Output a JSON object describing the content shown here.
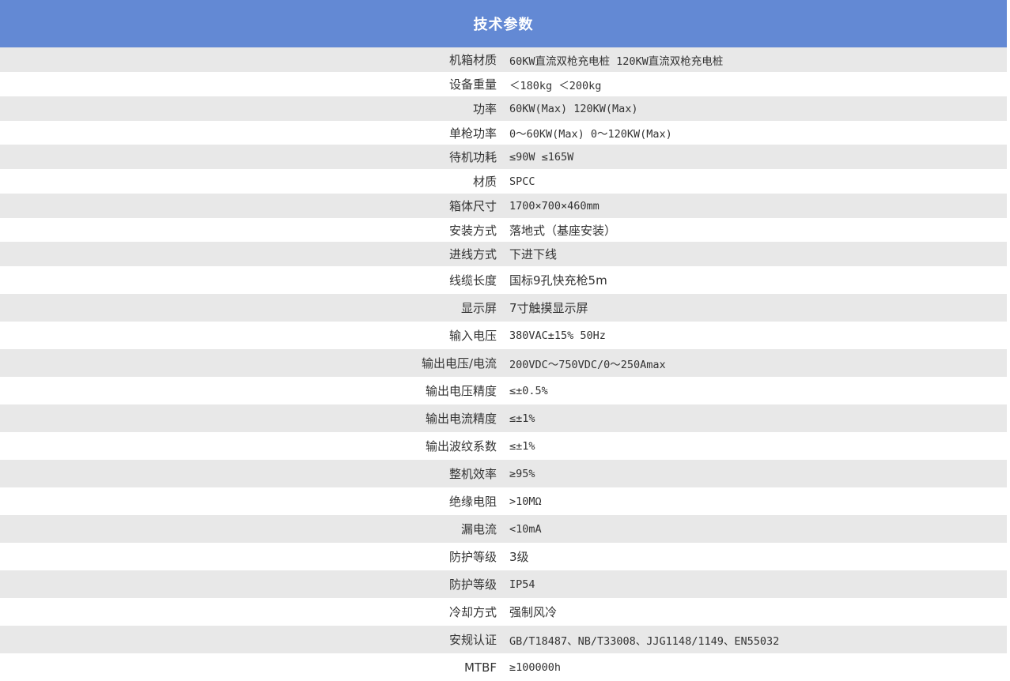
{
  "header": {
    "title": "技术参数"
  },
  "colors": {
    "header_bg": "#6389d4",
    "row_alt_bg": "#e8e8e8",
    "text": "#333333"
  },
  "rows": [
    {
      "label": "机箱材质",
      "value": "60KW直流双枪充电桩 120KW直流双枪充电桩"
    },
    {
      "label": "设备重量",
      "value": "＜180kg ＜200kg"
    },
    {
      "label": "功率",
      "value": "60KW(Max) 120KW(Max)"
    },
    {
      "label": "单枪功率",
      "value": "0～60KW(Max) 0～120KW(Max)"
    },
    {
      "label": "待机功耗",
      "value": "≤90W ≤165W"
    },
    {
      "label": "材质",
      "value": "SPCC"
    },
    {
      "label": "箱体尺寸",
      "value": "1700×700×460mm"
    },
    {
      "label": "安装方式",
      "value": "落地式（基座安装）"
    },
    {
      "label": "进线方式",
      "value": "下进下线"
    },
    {
      "label": "线缆长度",
      "value": "国标9孔快充枪5m"
    },
    {
      "label": "显示屏",
      "value": "7寸触摸显示屏"
    },
    {
      "label": "输入电压",
      "value": "380VAC±15%  50Hz"
    },
    {
      "label": "输出电压/电流",
      "value": "200VDC～750VDC/0～250Amax"
    },
    {
      "label": "输出电压精度",
      "value": "≤±0.5%"
    },
    {
      "label": "输出电流精度",
      "value": "≤±1%"
    },
    {
      "label": "输出波纹系数",
      "value": "≤±1%"
    },
    {
      "label": "整机效率",
      "value": "≥95%"
    },
    {
      "label": "绝缘电阻",
      "value": ">10MΩ"
    },
    {
      "label": "漏电流",
      "value": "<10mA"
    },
    {
      "label": "防护等级",
      "value": "3级"
    },
    {
      "label": "防护等级",
      "value": "IP54"
    },
    {
      "label": "冷却方式",
      "value": "强制风冷"
    },
    {
      "label": "安规认证",
      "value": "GB/T18487、NB/T33008、JJG1148/1149、EN55032"
    },
    {
      "label": "MTBF",
      "value": "≥100000h"
    }
  ]
}
